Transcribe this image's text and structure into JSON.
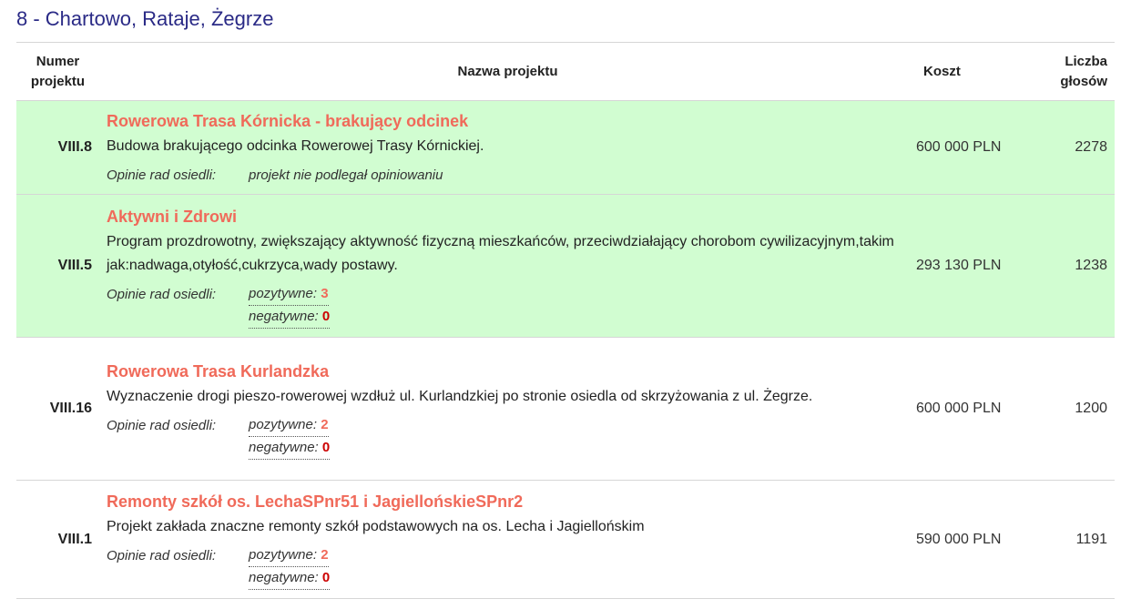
{
  "district": {
    "title": "8 - Chartowo, Rataje, Żegrze"
  },
  "headers": {
    "number_line1": "Numer",
    "number_line2": "projektu",
    "name": "Nazwa projektu",
    "cost": "Koszt",
    "votes_line1": "Liczba",
    "votes_line2": "głosów"
  },
  "labels": {
    "opinions": "Opinie rad osiedli:",
    "positive": "pozytywne:",
    "negative": "negatywne:"
  },
  "colors": {
    "funded_row_bg": "#d1fdd1",
    "title_accent": "#f06a5a",
    "negative_value": "#cc0000",
    "district_title": "#2a2a86"
  },
  "projects": [
    {
      "number": "VIII.8",
      "title": "Rowerowa Trasa Kórnicka - brakujący odcinek",
      "description": "Budowa brakującego odcinka Rowerowej Trasy Kórnickiej.",
      "opinion_text": "projekt nie podlegał opiniowaniu",
      "cost": "600 000 PLN",
      "votes": "2278",
      "funded": true
    },
    {
      "number": "VIII.5",
      "title": "Aktywni i Zdrowi",
      "description": "Program prozdrowotny, zwiększający aktywność fizyczną mieszkańców, przeciwdziałający chorobom cywilizacyjnym,takim jak:nadwaga,otyłość,cukrzyca,wady postawy.",
      "positive": "3",
      "negative": "0",
      "cost": "293 130 PLN",
      "votes": "1238",
      "funded": true
    },
    {
      "number": "VIII.16",
      "title": "Rowerowa Trasa Kurlandzka",
      "description": "Wyznaczenie drogi pieszo-rowerowej wzdłuż ul. Kurlandzkiej po stronie osiedla od skrzyżowania z ul. Żegrze.",
      "positive": "2",
      "negative": "0",
      "cost": "600 000 PLN",
      "votes": "1200",
      "funded": false
    },
    {
      "number": "VIII.1",
      "title": "Remonty szkół os. LechaSPnr51 i JagiellońskieSPnr2",
      "description": "Projekt zakłada znaczne remonty szkół podstawowych na os. Lecha i Jagiellońskim",
      "positive": "2",
      "negative": "0",
      "cost": "590 000 PLN",
      "votes": "1191",
      "funded": false
    }
  ]
}
